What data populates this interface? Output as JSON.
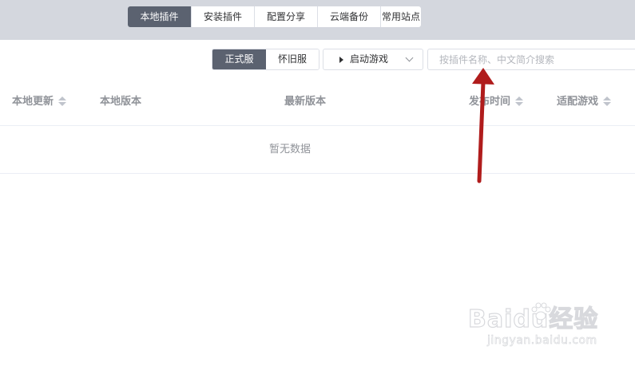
{
  "tabs": [
    {
      "label": "本地插件",
      "active": true
    },
    {
      "label": "安装插件",
      "active": false
    },
    {
      "label": "配置分享",
      "active": false
    },
    {
      "label": "云端备份",
      "active": false
    },
    {
      "label": "常用站点",
      "active": false
    }
  ],
  "toolbar": {
    "server_options": [
      {
        "label": "正式服",
        "active": true
      },
      {
        "label": "怀旧服",
        "active": false
      }
    ],
    "launch_label": "启动游戏",
    "search_placeholder": "按插件名称、中文简介搜索",
    "search_value": ""
  },
  "table": {
    "columns": [
      {
        "label": "本地更新",
        "sortable": true
      },
      {
        "label": "本地版本",
        "sortable": false
      },
      {
        "label": "最新版本",
        "sortable": false
      },
      {
        "label": "发布时间",
        "sortable": true
      },
      {
        "label": "适配游戏",
        "sortable": true
      }
    ],
    "empty_text": "暂无数据"
  },
  "watermark": {
    "logo": "Baidu经验",
    "url": "jingyan.baidu.com"
  },
  "colors": {
    "header_bg": "#d4d7de",
    "active_tab": "#5b6270",
    "annotation_arrow": "#b01c1c"
  }
}
